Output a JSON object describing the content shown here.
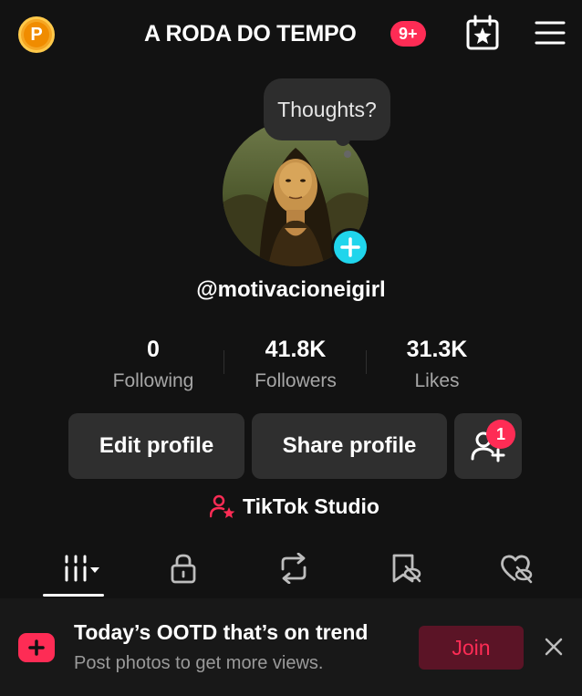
{
  "header": {
    "coin_letter": "P",
    "title": "A RODA DO TEMPO",
    "notification_badge": "9+"
  },
  "profile": {
    "speech_bubble": "Thoughts?",
    "username": "@motivacioneigirl"
  },
  "stats": [
    {
      "value": "0",
      "label": "Following"
    },
    {
      "value": "41.8K",
      "label": "Followers"
    },
    {
      "value": "31.3K",
      "label": "Likes"
    }
  ],
  "actions": {
    "edit_profile": "Edit profile",
    "share_profile": "Share profile",
    "friend_requests_count": "1"
  },
  "studio": {
    "label": "TikTok Studio"
  },
  "tabs": [
    {
      "icon": "videos-grid-icon",
      "active": true
    },
    {
      "icon": "lock-icon",
      "active": false
    },
    {
      "icon": "repost-icon",
      "active": false
    },
    {
      "icon": "favorites-hidden-icon",
      "active": false
    },
    {
      "icon": "liked-hidden-icon",
      "active": false
    }
  ],
  "banner": {
    "title": "Today’s OOTD that’s on trend",
    "subtitle": "Post photos to get more views.",
    "join_label": "Join"
  },
  "colors": {
    "background": "#121212",
    "accent": "#fe2c55",
    "add_button": "#20d5ec",
    "coin": "#f5a623"
  }
}
